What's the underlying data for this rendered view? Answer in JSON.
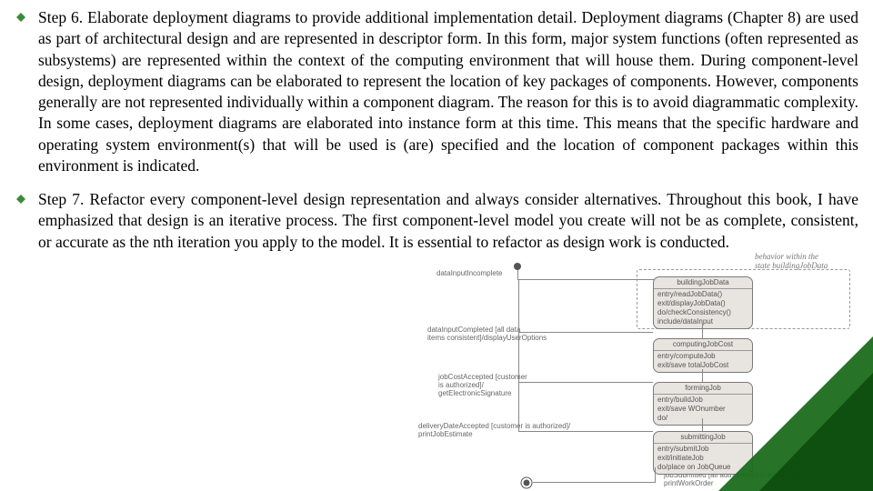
{
  "bullets": [
    {
      "text": "Step 6. Elaborate deployment diagrams to provide additional implementation detail. Deployment diagrams (Chapter 8) are used as part of architectural design and are represented in descriptor form. In this form, major system functions (often represented as subsystems) are represented within the context of the computing environment that will house them. During component-level design, deployment diagrams can be elaborated to represent the location of key packages of components. However, components generally are not represented individually within a component diagram. The reason for this is to avoid diagrammatic complexity. In some cases, deployment diagrams are elaborated into instance form at this time. This means that the specific hardware and operating system environment(s) that will be used is (are) specified and the location of component packages within this environment is indicated."
    },
    {
      "text": "Step 7. Refactor every component-level design representation and always consider alternatives. Throughout this book, I have emphasized that design is an iterative process. The first component-level model you create will not be as complete, consistent, or accurate as the nth iteration you apply to the model. It is essential to refactor as design work is conducted."
    }
  ],
  "diagram": {
    "annot_top": "behavior within the\nstate buildingJobData",
    "labels": {
      "l0": "dataInputIncomplete",
      "l1": "dataInputCompleted [all data\nitems consistent]/displayUserOptions",
      "l2": "jobCostAccepted [customer\nis authorized]/\ngetElectronicSignature",
      "l3": "deliveryDateAccepted [customer is authorized]/\nprintJobEstimate",
      "l4": "jobSubmitted [all authorizations acquired]/\nprintWorkOrder"
    },
    "states": [
      {
        "title": "buildingJobData",
        "body": "entry/readJobData()\nexit/displayJobData()\ndo/checkConsistency()\ninclude/dataInput"
      },
      {
        "title": "computingJobCost",
        "body": "entry/computeJob\nexit/save totalJobCost"
      },
      {
        "title": "formingJob",
        "body": "entry/buildJob\nexit/save WOnumber\ndo/"
      },
      {
        "title": "submittingJob",
        "body": "entry/submitJob\nexit/initiateJob\ndo/place on JobQueue"
      }
    ]
  }
}
